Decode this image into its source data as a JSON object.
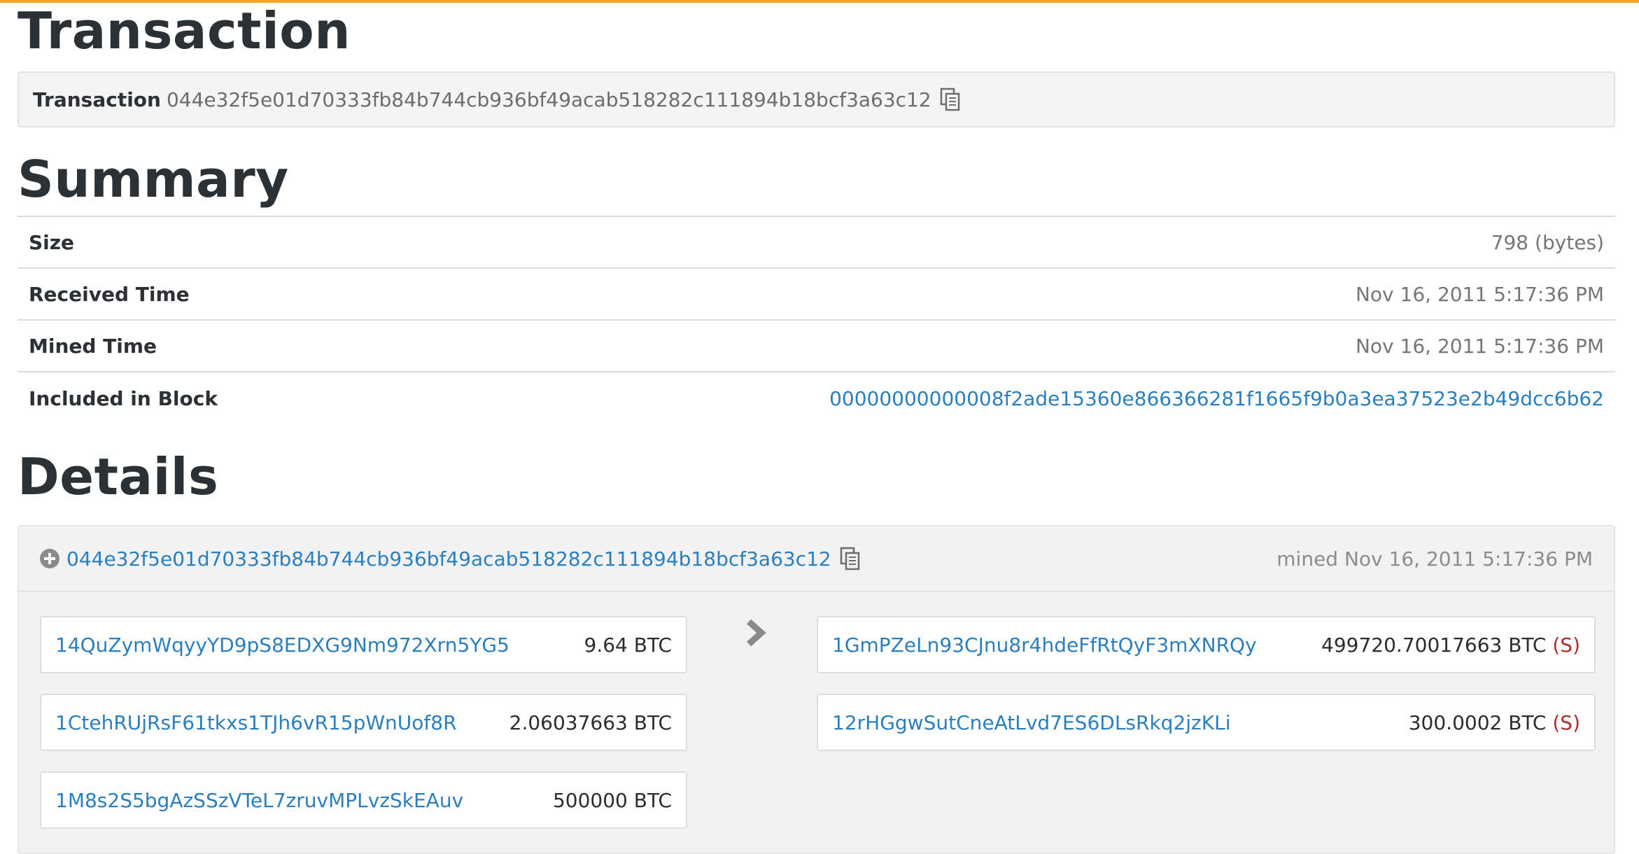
{
  "colors": {
    "accent_top": "#f6a623",
    "link": "#2a7fc0",
    "spent": "#b52a2a"
  },
  "headings": {
    "transaction": "Transaction",
    "summary": "Summary",
    "details": "Details"
  },
  "transaction": {
    "label": "Transaction",
    "hash": "044e32f5e01d70333fb84b744cb936bf49acab518282c111894b18bcf3a63c12",
    "copy_icon": "copy-icon"
  },
  "summary": {
    "rows": [
      {
        "key": "Size",
        "value": "798 (bytes)"
      },
      {
        "key": "Received Time",
        "value": "Nov 16, 2011 5:17:36 PM"
      },
      {
        "key": "Mined Time",
        "value": "Nov 16, 2011 5:17:36 PM"
      },
      {
        "key": "Included in Block",
        "value": "00000000000008f2ade15360e866366281f1665f9b0a3ea37523e2b49dcc6b62"
      }
    ]
  },
  "details": {
    "tx_hash": "044e32f5e01d70333fb84b744cb936bf49acab518282c111894b18bcf3a63c12",
    "mined": "mined Nov 16, 2011 5:17:36 PM",
    "inputs": [
      {
        "address": "14QuZymWqyyYD9pS8EDXG9Nm972Xrn5YG5",
        "amount": "9.64 BTC"
      },
      {
        "address": "1CtehRUjRsF61tkxs1TJh6vR15pWnUof8R",
        "amount": "2.06037663 BTC"
      },
      {
        "address": "1M8s2S5bgAzSSzVTeL7zruvMPLvzSkEAuv",
        "amount": "500000 BTC"
      }
    ],
    "outputs": [
      {
        "address": "1GmPZeLn93CJnu8r4hdeFfRtQyF3mXNRQy",
        "amount": "499720.70017663 BTC",
        "spent": "(S)"
      },
      {
        "address": "12rHGgwSutCneAtLvd7ES6DLsRkq2jzKLi",
        "amount": "300.0002 BTC",
        "spent": "(S)"
      }
    ]
  }
}
